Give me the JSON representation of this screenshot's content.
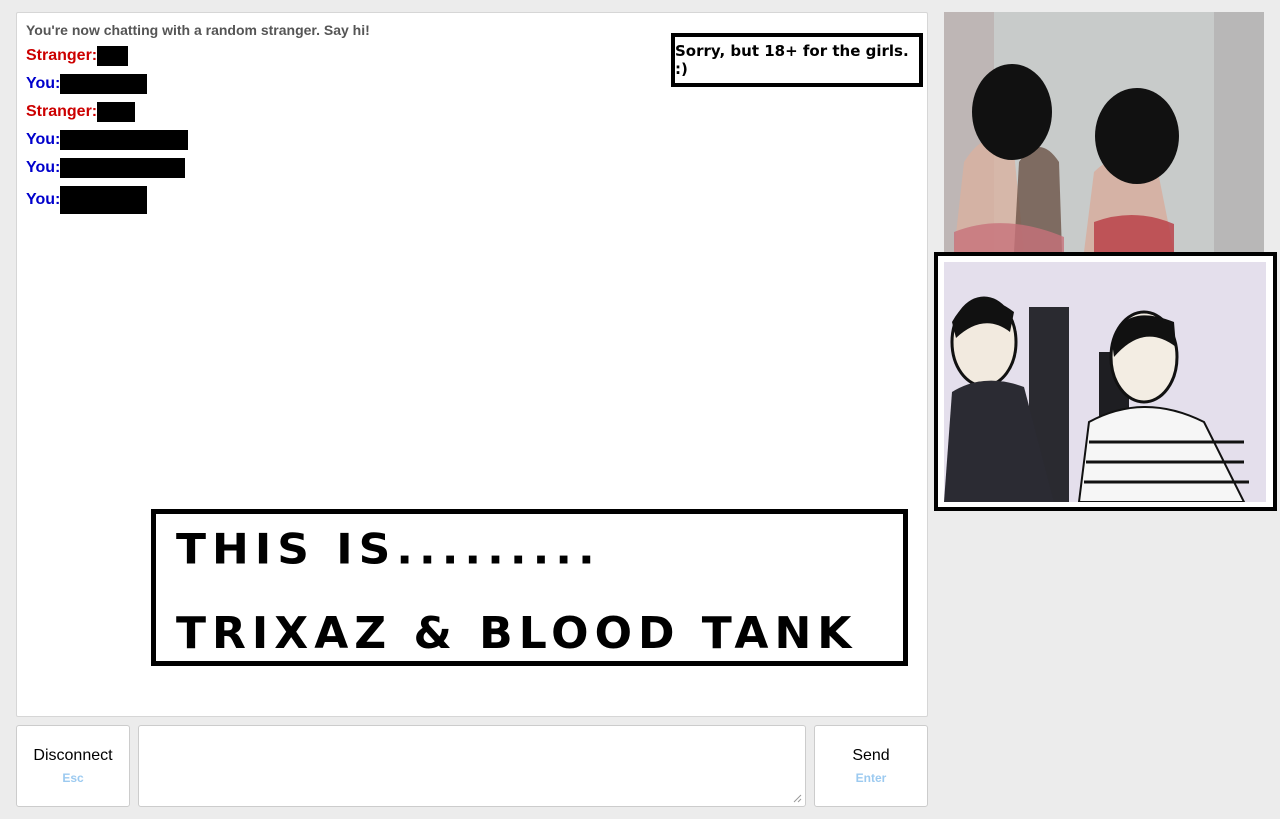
{
  "chat": {
    "status": "You're now chatting with a random stranger. Say hi!",
    "messages": [
      {
        "sender": "Stranger:",
        "type": "stranger"
      },
      {
        "sender": "You:",
        "type": "you"
      },
      {
        "sender": "Stranger:",
        "type": "stranger"
      },
      {
        "sender": "You:",
        "type": "you"
      },
      {
        "sender": "You:",
        "type": "you"
      },
      {
        "sender": "You:",
        "type": "you"
      }
    ]
  },
  "signs": {
    "sorry": "Sorry, but 18+ for the girls. :)",
    "title_line1": "THIS IS.........",
    "title_line2": "TRIXAZ & BLOOD TANK"
  },
  "controls": {
    "disconnect_label": "Disconnect",
    "disconnect_hint": "Esc",
    "send_label": "Send",
    "send_hint": "Enter",
    "message_value": ""
  },
  "colors": {
    "stranger": "#cc0000",
    "you": "#0000cc",
    "hint": "#9ccaf0"
  }
}
